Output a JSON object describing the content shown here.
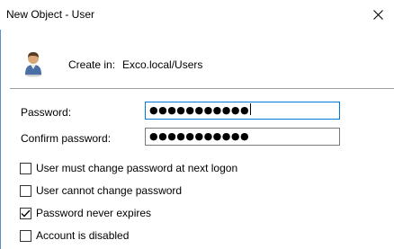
{
  "window": {
    "title": "New Object - User",
    "close_symbol": "✕"
  },
  "header": {
    "create_in_label": "Create in:",
    "create_in_value": "Exco.local/Users",
    "icon": "user-icon"
  },
  "fields": {
    "password_label": "Password:",
    "password_value": "●●●●●●●●●●●",
    "confirm_label": "Confirm password:",
    "confirm_value": "●●●●●●●●●●●"
  },
  "options": [
    {
      "label": "User must change password at next logon",
      "checked": false
    },
    {
      "label": "User cannot change password",
      "checked": false
    },
    {
      "label": "Password never expires",
      "checked": true
    },
    {
      "label": "Account is disabled",
      "checked": false
    }
  ],
  "colors": {
    "focus_border": "#0078d7",
    "window_edge": "#5a8fd0"
  }
}
